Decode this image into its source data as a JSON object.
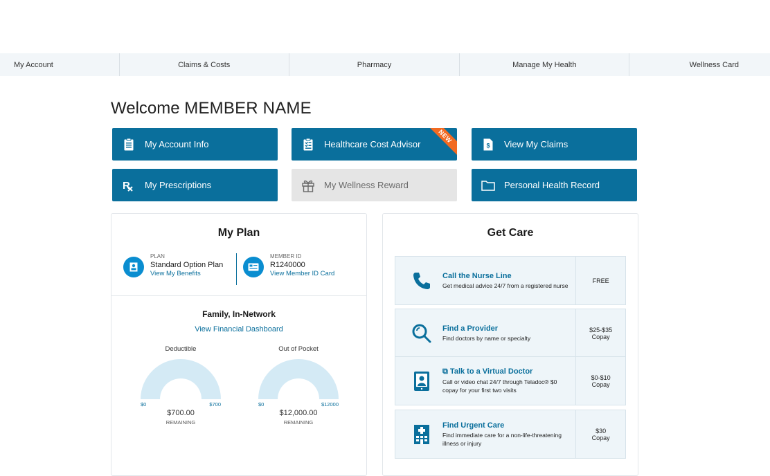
{
  "nav": {
    "items": [
      "My Account",
      "Claims & Costs",
      "Pharmacy",
      "Manage My Health",
      "Wellness Card"
    ]
  },
  "welcome": {
    "greeting": "Welcome",
    "member_name": "MEMBER NAME"
  },
  "tiles": [
    {
      "label": "My Account Info",
      "icon": "clipboard-list-icon"
    },
    {
      "label": "Healthcare Cost Advisor",
      "icon": "checklist-icon",
      "badge": "NEW"
    },
    {
      "label": "View My Claims",
      "icon": "dollar-document-icon"
    },
    {
      "label": "My Prescriptions",
      "icon": "rx-icon"
    },
    {
      "label": "My Wellness Reward",
      "icon": "gift-icon",
      "disabled": true
    },
    {
      "label": "Personal Health Record",
      "icon": "folder-icon"
    }
  ],
  "my_plan": {
    "title": "My Plan",
    "plan": {
      "label": "PLAN",
      "value": "Standard Option Plan",
      "link": "View My Benefits"
    },
    "member": {
      "label": "MEMBER ID",
      "value": "R1240000",
      "link": "View Member ID Card"
    },
    "coverage_title": "Family, In-Network",
    "dashboard_link": "View Financial Dashboard",
    "gauges": [
      {
        "label": "Deductible",
        "min": "$0",
        "max": "$700",
        "amount": "$700.00",
        "remaining_label": "REMAINING",
        "used_fraction": 0
      },
      {
        "label": "Out of Pocket",
        "min": "$0",
        "max": "$12000",
        "amount": "$12,000.00",
        "remaining_label": "REMAINING",
        "used_fraction": 0
      }
    ]
  },
  "get_care": {
    "title": "Get Care",
    "items": [
      {
        "title": "Call the Nurse Line",
        "desc": "Get medical advice 24/7 from a registered nurse",
        "cost": "FREE",
        "cost_sub": "",
        "icon": "phone-icon"
      },
      {
        "title": "Find a Provider",
        "desc": "Find doctors by name or specialty",
        "cost": "$25-$35",
        "cost_sub": "Copay",
        "icon": "search-icon"
      },
      {
        "title": "Talk to a Virtual Doctor",
        "desc": "Call or video chat 24/7 through Teladoc® $0 copay for your first two visits",
        "cost": "$0-$10",
        "cost_sub": "Copay",
        "icon": "tablet-doctor-icon"
      },
      {
        "title": "Find Urgent Care",
        "desc": "Find immediate care for a non-life-threatening illness or injury",
        "cost": "$30",
        "cost_sub": "Copay",
        "icon": "hospital-icon"
      }
    ]
  },
  "colors": {
    "primary": "#0a6f9c",
    "accent_badge": "#f26a21",
    "gauge_fill": "#d4eaf5"
  }
}
